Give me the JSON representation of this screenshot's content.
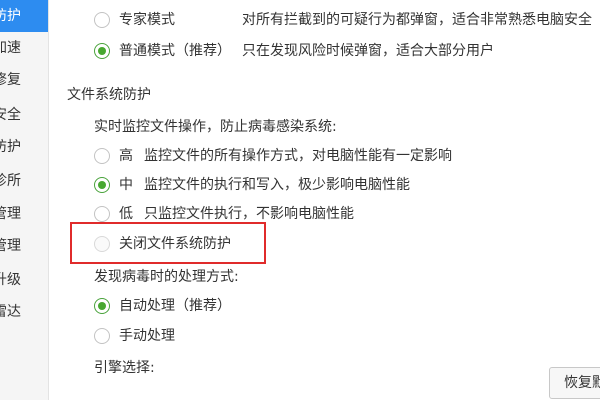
{
  "sidebar": {
    "items": [
      {
        "label": "防护",
        "active": true
      },
      {
        "label": "加速"
      },
      {
        "label": "修复"
      },
      {
        "label": "安全"
      },
      {
        "label": "防护"
      },
      {
        "label": "诊所"
      },
      {
        "label": "管理"
      },
      {
        "label": "管理"
      },
      {
        "label": "升级"
      },
      {
        "label": "雷达"
      }
    ]
  },
  "popup_mode": {
    "options": [
      {
        "label": "专家模式",
        "description": "对所有拦截到的可疑行为都弹窗，适合非常熟悉电脑安全",
        "checked": false
      },
      {
        "label": "普通模式（推荐）",
        "description": "只在发现风险时候弹窗，适合大部分用户",
        "checked": true
      }
    ]
  },
  "file_protection": {
    "title": "文件系统防护",
    "realtime_label": "实时监控文件操作，防止病毒感染系统:",
    "levels": [
      {
        "label": "高",
        "description": "监控文件的所有操作方式，对电脑性能有一定影响",
        "checked": false
      },
      {
        "label": "中",
        "description": "监控文件的执行和写入，极少影响电脑性能",
        "checked": true
      },
      {
        "label": "低",
        "description": "只监控文件执行，不影响电脑性能",
        "checked": false
      },
      {
        "label": "关闭文件系统防护",
        "description": "",
        "checked": false
      }
    ]
  },
  "virus_handling": {
    "label": "发现病毒时的处理方式:",
    "options": [
      {
        "label": "自动处理（推荐）",
        "checked": true
      },
      {
        "label": "手动处理",
        "checked": false
      }
    ]
  },
  "engine": {
    "label": "引擎选择:"
  },
  "footer": {
    "restore_label": "恢复默认"
  },
  "colors": {
    "accent": "#2d8cf0",
    "radio_checked": "#47a830",
    "highlight": "#e02b2b"
  }
}
